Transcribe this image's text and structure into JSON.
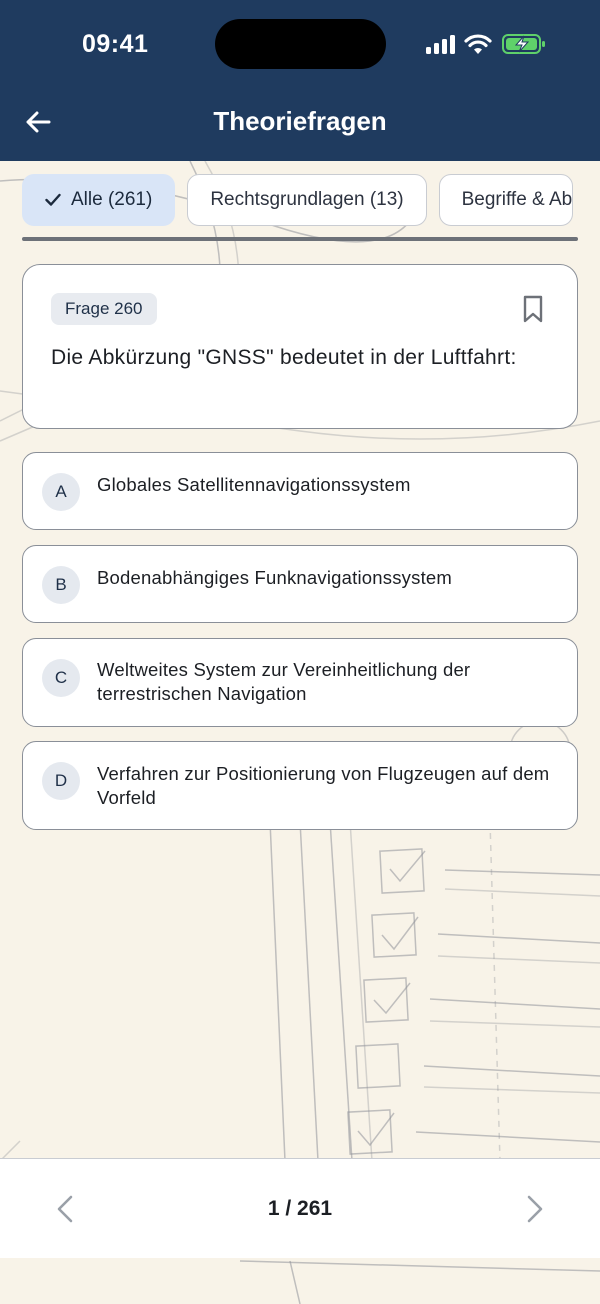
{
  "status_bar": {
    "time": "09:41"
  },
  "header": {
    "title": "Theoriefragen",
    "back_icon": "arrow-left-icon",
    "background_color": "#1f3b5f"
  },
  "filters": [
    {
      "label": "Alle (261)",
      "selected": true
    },
    {
      "label": "Rechtsgrundlagen (13)",
      "selected": false
    },
    {
      "label": "Begriffe & Ab",
      "selected": false
    }
  ],
  "question": {
    "badge": "Frage 260",
    "text": "Die Abkürzung \"GNSS\" bedeutet in der Luftfahrt:",
    "bookmark_icon": "bookmark-icon"
  },
  "answers": [
    {
      "letter": "A",
      "text": "Globales Satellitennavigationssystem"
    },
    {
      "letter": "B",
      "text": "Bodenabhängiges Funknavigationssystem"
    },
    {
      "letter": "C",
      "text": "Weltweites System zur Vereinheitlichung der terrestrischen Navigation"
    },
    {
      "letter": "D",
      "text": "Verfahren zur Positionierung von Flugzeugen auf dem Vorfeld"
    }
  ],
  "pagination": {
    "counter": "1 / 261",
    "prev_icon": "chevron-left-icon",
    "next_icon": "chevron-right-icon"
  }
}
